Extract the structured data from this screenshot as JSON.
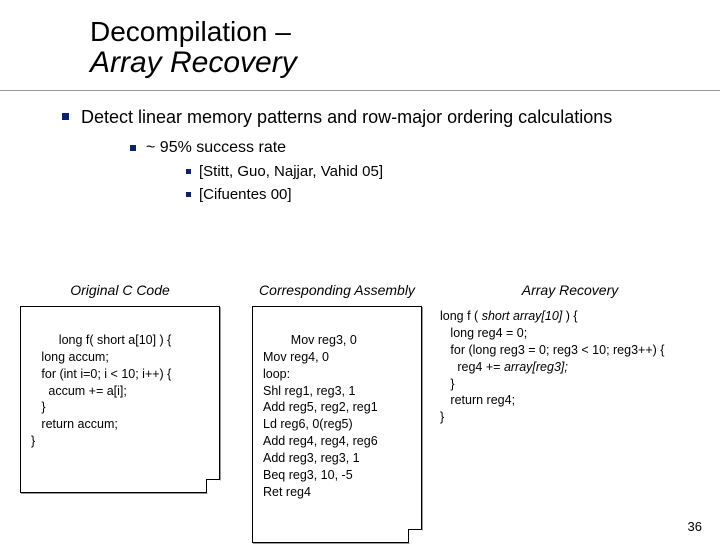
{
  "title": {
    "line1": "Decompilation –",
    "line2": "Array Recovery"
  },
  "bullets": {
    "l1_text": "Detect linear memory patterns and row-major ordering calculations",
    "l2_text": "~ 95% success rate",
    "l3_a": "[Stitt, Guo, Najjar, Vahid 05]",
    "l3_b": "[Cifuentes 00]"
  },
  "columns": {
    "c1_header": "Original C Code",
    "c2_header": "Corresponding Assembly",
    "c3_header": "Array Recovery",
    "c1_code": "long f( short a[10] ) {\n   long accum;\n   for (int i=0; i < 10; i++) {\n     accum += a[i];\n   }\n   return accum;\n}",
    "c2_code": "Mov reg3, 0\nMov reg4, 0\nloop:\nShl reg1, reg3, 1\nAdd reg5, reg2, reg1\nLd reg6, 0(reg5)\nAdd reg4, reg4, reg6\nAdd reg3, reg3, 1\nBeq reg3, 10, -5\nRet reg4",
    "c3_code_html": "long f ( <em>short array[10]</em> ) {\n   long reg4 = 0;\n   for (long reg3 = 0; reg3 &lt; 10; reg3++) {\n     reg4 += <em>array[reg3];</em>\n   }\n   return reg4;\n}"
  },
  "slide_number": "36"
}
